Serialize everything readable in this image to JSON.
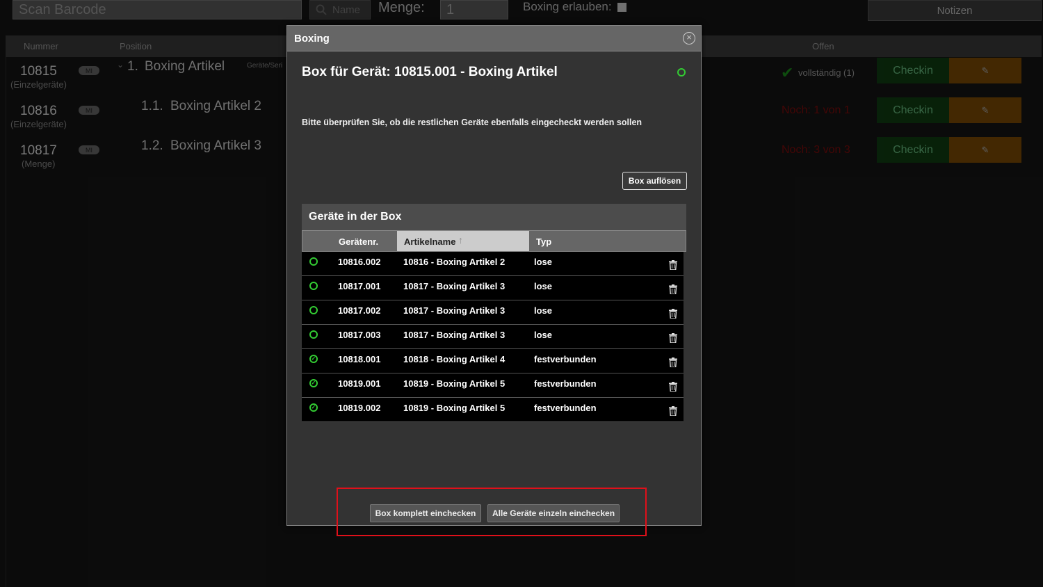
{
  "background": {
    "scan_placeholder": "Scan Barcode",
    "name_button": "Name",
    "menge_label": "Menge:",
    "menge_value": "1",
    "boxing_allowed_label": "Boxing erlauben:",
    "notes_button": "Notizen",
    "columns": {
      "nummer": "Nummer",
      "position": "Position",
      "offen": "Offen"
    },
    "rows": [
      {
        "nummer": "10815",
        "type": "(Einzelgeräte)",
        "badge": "MI",
        "index": "1.",
        "name": "Boxing Artikel",
        "extra": "Geräte/Seri",
        "status": "vollständig (1)",
        "checkin": "Checkin"
      },
      {
        "nummer": "10816",
        "type": "(Einzelgeräte)",
        "badge": "MI",
        "index": "1.1.",
        "name": "Boxing Artikel 2",
        "status": "Noch: 1 von 1",
        "checkin": "Checkin"
      },
      {
        "nummer": "10817",
        "type": "(Menge)",
        "badge": "MI",
        "index": "1.2.",
        "name": "Boxing Artikel 3",
        "status": "Noch: 3 von 3",
        "checkin": "Checkin"
      }
    ]
  },
  "modal": {
    "header": "Boxing",
    "title": "Box für Gerät: 10815.001 - Boxing Artikel",
    "message": "Bitte überprüfen Sie, ob die restlichen Geräte ebenfalls eingecheckt werden sollen",
    "dissolve_button": "Box auflösen",
    "section_title": "Geräte in der Box",
    "columns": {
      "number": "Gerätenr.",
      "article": "Artikelname",
      "type": "Typ"
    },
    "devices": [
      {
        "number": "10816.002",
        "article": "10816 - Boxing Artikel 2",
        "type": "lose",
        "checked": false
      },
      {
        "number": "10817.001",
        "article": "10817 - Boxing Artikel 3",
        "type": "lose",
        "checked": false
      },
      {
        "number": "10817.002",
        "article": "10817 - Boxing Artikel 3",
        "type": "lose",
        "checked": false
      },
      {
        "number": "10817.003",
        "article": "10817 - Boxing Artikel 3",
        "type": "lose",
        "checked": false
      },
      {
        "number": "10818.001",
        "article": "10818 - Boxing Artikel 4",
        "type": "festverbunden",
        "checked": true
      },
      {
        "number": "10819.001",
        "article": "10819 - Boxing Artikel 5",
        "type": "festverbunden",
        "checked": true
      },
      {
        "number": "10819.002",
        "article": "10819 - Boxing Artikel 5",
        "type": "festverbunden",
        "checked": true
      }
    ],
    "checkin_box_button": "Box komplett einchecken",
    "checkin_all_button": "Alle Geräte einzeln einchecken"
  },
  "colors": {
    "accent_green": "#33cc33",
    "highlight_red": "#e0101a",
    "checkin_green": "#0d4d12",
    "edit_orange": "#7a4a05"
  }
}
